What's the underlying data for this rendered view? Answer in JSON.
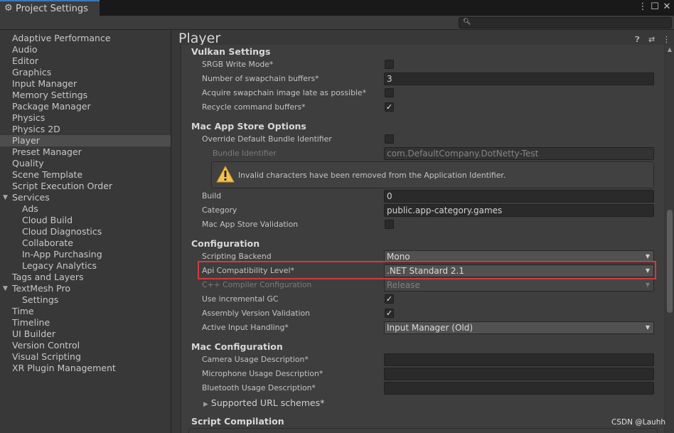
{
  "window": {
    "tab_title": "Project Settings",
    "icons": [
      "gear-icon",
      "more-vert-icon",
      "maximize-icon",
      "close-icon"
    ]
  },
  "search": {
    "placeholder": "",
    "icon": "search-icon"
  },
  "sidebar": {
    "items": [
      {
        "label": "Adaptive Performance"
      },
      {
        "label": "Audio"
      },
      {
        "label": "Editor"
      },
      {
        "label": "Graphics"
      },
      {
        "label": "Input Manager"
      },
      {
        "label": "Memory Settings"
      },
      {
        "label": "Package Manager"
      },
      {
        "label": "Physics"
      },
      {
        "label": "Physics 2D"
      },
      {
        "label": "Player",
        "selected": true
      },
      {
        "label": "Preset Manager"
      },
      {
        "label": "Quality"
      },
      {
        "label": "Scene Template"
      },
      {
        "label": "Script Execution Order"
      },
      {
        "label": "Services",
        "expanded": true
      },
      {
        "label": "Ads"
      },
      {
        "label": "Cloud Build"
      },
      {
        "label": "Cloud Diagnostics"
      },
      {
        "label": "Collaborate"
      },
      {
        "label": "In-App Purchasing"
      },
      {
        "label": "Legacy Analytics"
      },
      {
        "label": "Tags and Layers"
      },
      {
        "label": "TextMesh Pro",
        "expanded": true
      },
      {
        "label": "Settings"
      },
      {
        "label": "Time"
      },
      {
        "label": "Timeline"
      },
      {
        "label": "UI Builder"
      },
      {
        "label": "Version Control"
      },
      {
        "label": "Visual Scripting"
      },
      {
        "label": "XR Plugin Management"
      }
    ]
  },
  "main": {
    "title": "Player",
    "header_icons": [
      "help-icon",
      "presets-icon",
      "more-vert-icon"
    ],
    "vulkan": {
      "title": "Vulkan Settings",
      "srgb_label": "SRGB Write Mode*",
      "srgb_checked": false,
      "swapchain_label": "Number of swapchain buffers*",
      "swapchain_value": "3",
      "acquire_label": "Acquire swapchain image late as possible*",
      "acquire_checked": false,
      "recycle_label": "Recycle command buffers*",
      "recycle_checked": true
    },
    "macstore": {
      "title": "Mac App Store Options",
      "override_label": "Override Default Bundle Identifier",
      "override_checked": false,
      "bundle_label": "Bundle Identifier",
      "bundle_value": "com.DefaultCompany.DotNetty-Test",
      "warning": "Invalid characters have been removed from the Application Identifier.",
      "build_label": "Build",
      "build_value": "0",
      "category_label": "Category",
      "category_value": "public.app-category.games",
      "validation_label": "Mac App Store Validation",
      "validation_checked": false
    },
    "config": {
      "title": "Configuration",
      "backend_label": "Scripting Backend",
      "backend_value": "Mono",
      "api_label": "Api Compatibility Level*",
      "api_value": ".NET Standard 2.1",
      "cpp_label": "C++ Compiler Configuration",
      "cpp_value": "Release",
      "incgc_label": "Use incremental GC",
      "incgc_checked": true,
      "asmval_label": "Assembly Version Validation",
      "asmval_checked": true,
      "input_label": "Active Input Handling*",
      "input_value": "Input Manager (Old)"
    },
    "macconfig": {
      "title": "Mac Configuration",
      "camera_label": "Camera Usage Description*",
      "camera_value": "",
      "mic_label": "Microphone Usage Description*",
      "mic_value": "",
      "bt_label": "Bluetooth Usage Description*",
      "bt_value": "",
      "url_schemes_label": "Supported URL schemes*"
    },
    "script_compilation_title": "Script Compilation"
  },
  "watermark": "CSDN @Lauhh",
  "colors": {
    "highlight": "#d33a3a",
    "selected_row": "#4d4d4d",
    "tab_accent": "#3a79bb"
  }
}
